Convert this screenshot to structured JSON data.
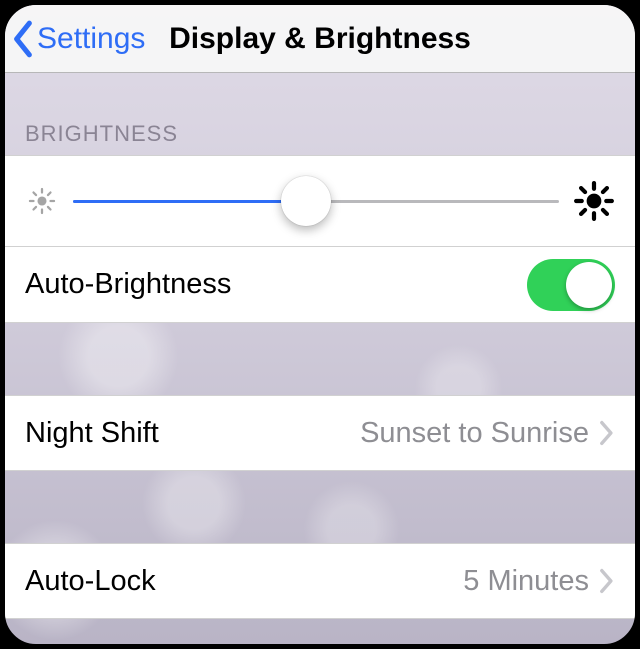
{
  "navbar": {
    "back_label": "Settings",
    "title": "Display & Brightness"
  },
  "sections": {
    "brightness_header": "BRIGHTNESS"
  },
  "brightness": {
    "slider_percent": 48,
    "auto_label": "Auto-Brightness",
    "auto_on": true
  },
  "night_shift": {
    "label": "Night Shift",
    "value": "Sunset to Sunrise"
  },
  "auto_lock": {
    "label": "Auto-Lock",
    "value": "5 Minutes"
  },
  "colors": {
    "tint": "#2e6df6",
    "toggle_on": "#30d158"
  }
}
